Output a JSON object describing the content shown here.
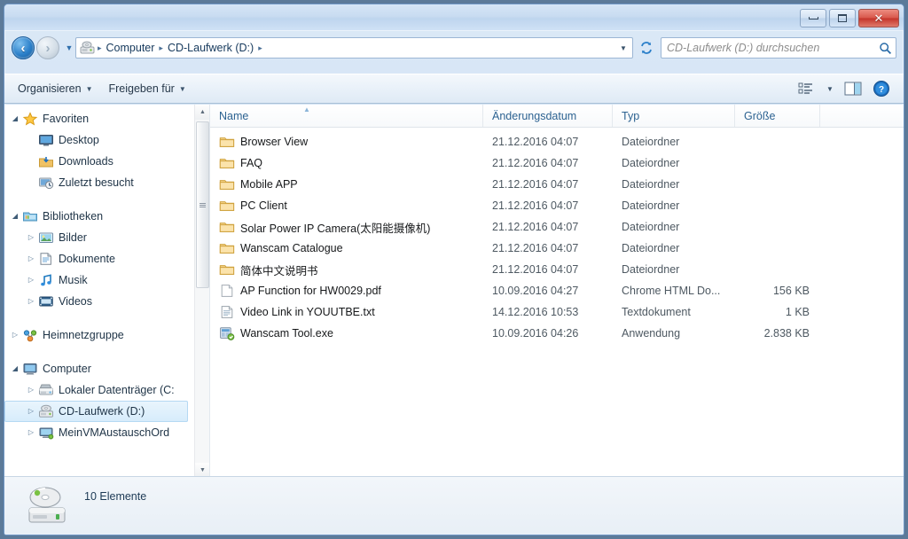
{
  "window": {
    "title": "",
    "buttons": {
      "minimize": "Minimieren",
      "maximize": "Maximieren",
      "close": "Schließen"
    }
  },
  "address": {
    "back_label": "Zurück",
    "forward_label": "Vorwärts",
    "recent_label": "Zuletzt besuchte Seiten",
    "dropdown_label": "Vorherige Orte",
    "refresh_label": "Aktualisieren",
    "icon": "cd-drive-icon",
    "crumbs": [
      "Computer",
      "CD-Laufwerk (D:)"
    ],
    "separator": "▸"
  },
  "search": {
    "placeholder": "CD-Laufwerk (D:) durchsuchen",
    "value": "",
    "icon": "search-icon"
  },
  "toolbar": {
    "organize_label": "Organisieren",
    "share_label": "Freigeben für",
    "caret": "▼",
    "view_label": "Ansicht ändern",
    "preview_label": "Vorschaufenster",
    "help_label": "Hilfe",
    "help_glyph": "?"
  },
  "sidebar": {
    "groups": [
      {
        "items": [
          {
            "label": "Favoriten",
            "icon": "star-icon",
            "level": 1,
            "expander": "open",
            "selected": false
          },
          {
            "label": "Desktop",
            "icon": "desktop-icon",
            "level": 2,
            "expander": "none",
            "selected": false
          },
          {
            "label": "Downloads",
            "icon": "downloads-icon",
            "level": 2,
            "expander": "none",
            "selected": false
          },
          {
            "label": "Zuletzt besucht",
            "icon": "recent-places-icon",
            "level": 2,
            "expander": "none",
            "selected": false
          }
        ]
      },
      {
        "items": [
          {
            "label": "Bibliotheken",
            "icon": "libraries-icon",
            "level": 1,
            "expander": "open",
            "selected": false
          },
          {
            "label": "Bilder",
            "icon": "pictures-icon",
            "level": 2,
            "expander": "closed",
            "selected": false
          },
          {
            "label": "Dokumente",
            "icon": "documents-icon",
            "level": 2,
            "expander": "closed",
            "selected": false
          },
          {
            "label": "Musik",
            "icon": "music-icon",
            "level": 2,
            "expander": "closed",
            "selected": false
          },
          {
            "label": "Videos",
            "icon": "videos-icon",
            "level": 2,
            "expander": "closed",
            "selected": false
          }
        ]
      },
      {
        "items": [
          {
            "label": "Heimnetzgruppe",
            "icon": "homegroup-icon",
            "level": 1,
            "expander": "closed",
            "selected": false
          }
        ]
      },
      {
        "items": [
          {
            "label": "Computer",
            "icon": "computer-icon",
            "level": 1,
            "expander": "open",
            "selected": false
          },
          {
            "label": "Lokaler Datenträger (C:",
            "icon": "hard-drive-icon",
            "level": 2,
            "expander": "closed",
            "selected": false
          },
          {
            "label": "CD-Laufwerk (D:)",
            "icon": "cd-drive-icon",
            "level": 2,
            "expander": "closed",
            "selected": true
          },
          {
            "label": "MeinVMAustauschOrd",
            "icon": "network-drive-icon",
            "level": 2,
            "expander": "closed",
            "selected": false
          }
        ]
      }
    ],
    "scrollbar": {
      "up": "▲",
      "down": "▼"
    }
  },
  "filelist": {
    "columns": [
      {
        "key": "name",
        "label": "Name",
        "sorted": true,
        "sort_arrow": "▲"
      },
      {
        "key": "date",
        "label": "Änderungsdatum",
        "sorted": false
      },
      {
        "key": "type",
        "label": "Typ",
        "sorted": false
      },
      {
        "key": "size",
        "label": "Größe",
        "sorted": false
      }
    ],
    "rows": [
      {
        "name": "Browser View",
        "date": "21.12.2016 04:07",
        "type": "Dateiordner",
        "size": "",
        "icon": "folder-icon"
      },
      {
        "name": "FAQ",
        "date": "21.12.2016 04:07",
        "type": "Dateiordner",
        "size": "",
        "icon": "folder-icon"
      },
      {
        "name": "Mobile APP",
        "date": "21.12.2016 04:07",
        "type": "Dateiordner",
        "size": "",
        "icon": "folder-icon"
      },
      {
        "name": "PC Client",
        "date": "21.12.2016 04:07",
        "type": "Dateiordner",
        "size": "",
        "icon": "folder-icon"
      },
      {
        "name": "Solar Power IP Camera(太阳能摄像机)",
        "date": "21.12.2016 04:07",
        "type": "Dateiordner",
        "size": "",
        "icon": "folder-icon"
      },
      {
        "name": "Wanscam Catalogue",
        "date": "21.12.2016 04:07",
        "type": "Dateiordner",
        "size": "",
        "icon": "folder-icon"
      },
      {
        "name": "简体中文说明书",
        "date": "21.12.2016 04:07",
        "type": "Dateiordner",
        "size": "",
        "icon": "folder-icon"
      },
      {
        "name": "AP  Function for HW0029.pdf",
        "date": "10.09.2016 04:27",
        "type": "Chrome HTML Do...",
        "size": "156 KB",
        "icon": "pdf-file-icon"
      },
      {
        "name": "Video Link in YOUUTBE.txt",
        "date": "14.12.2016 10:53",
        "type": "Textdokument",
        "size": "1 KB",
        "icon": "text-file-icon"
      },
      {
        "name": "Wanscam Tool.exe",
        "date": "10.09.2016 04:26",
        "type": "Anwendung",
        "size": "2.838 KB",
        "icon": "application-icon"
      }
    ]
  },
  "statusbar": {
    "icon": "cd-drive-large-icon",
    "text": "10 Elemente"
  },
  "colors": {
    "accent": "#2a7fc9",
    "folder": "#f5d07e",
    "close_button": "#c4342a",
    "selection": "#d6ecfb",
    "column_header_text": "#2c6291",
    "secondary_text": "#4e5962"
  }
}
